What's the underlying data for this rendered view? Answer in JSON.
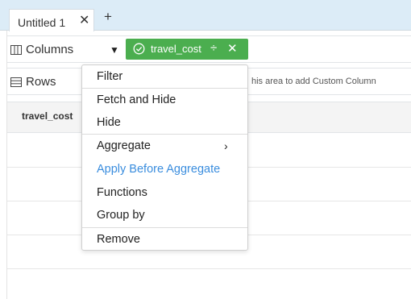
{
  "tabs": {
    "items": [
      {
        "label": "Untitled 1"
      }
    ],
    "close_glyph": "✕",
    "add_glyph": "+"
  },
  "columns_shelf": {
    "label": "Columns",
    "icon": "columns-icon",
    "dropdown_glyph": "▼",
    "pill": {
      "label": "travel_cost",
      "color": "#4bae4f",
      "check_icon": "circle-check-icon",
      "split_glyph": "÷",
      "close_glyph": "✕"
    }
  },
  "rows_shelf": {
    "label": "Rows",
    "icon": "rows-icon",
    "hint": "his area to add Custom Column"
  },
  "grid": {
    "header": "travel_cost"
  },
  "context_menu": {
    "items": [
      {
        "label": "Filter"
      },
      {
        "label": "Fetch and Hide"
      },
      {
        "label": "Hide"
      },
      {
        "label": "Aggregate",
        "submenu_glyph": "›"
      },
      {
        "label": "Apply Before Aggregate",
        "color": "#3a8dde"
      },
      {
        "label": "Functions"
      },
      {
        "label": "Group by"
      },
      {
        "label": "Remove"
      }
    ]
  }
}
